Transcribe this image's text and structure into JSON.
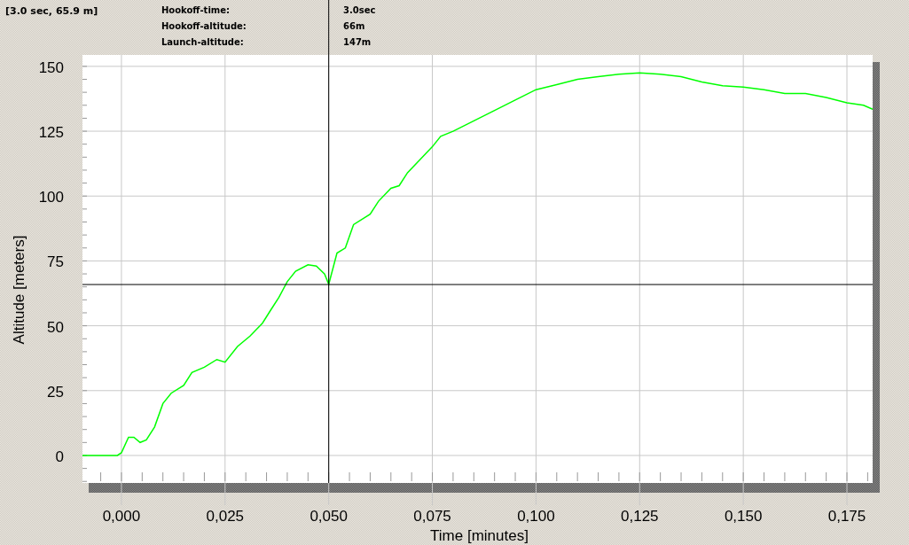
{
  "cursor_readout": "[3.0 sec, 65.9 m]",
  "stats": [
    {
      "label": "Hookoff-time:",
      "value": "3.0sec"
    },
    {
      "label": "Hookoff-altitude:",
      "value": "66m"
    },
    {
      "label": "Launch-altitude:",
      "value": "147m"
    }
  ],
  "chart": {
    "chart_data": {
      "type": "line",
      "xlabel": "Time [minutes]",
      "ylabel": "Altitude [meters]",
      "xlim": [
        -0.0094,
        0.1812
      ],
      "ylim": [
        -10.6,
        154.4
      ],
      "xticks": [
        {
          "value": 0,
          "label": "0,000"
        },
        {
          "value": 0.025,
          "label": "0,025"
        },
        {
          "value": 0.05,
          "label": "0,050"
        },
        {
          "value": 0.075,
          "label": "0,075"
        },
        {
          "value": 0.1,
          "label": "0,100"
        },
        {
          "value": 0.125,
          "label": "0,125"
        },
        {
          "value": 0.15,
          "label": "0,150"
        },
        {
          "value": 0.175,
          "label": "0,175"
        }
      ],
      "yticks": [
        0,
        25,
        50,
        75,
        100,
        125,
        150
      ],
      "x": [
        -0.0094,
        -0.001,
        0,
        0.0017,
        0.003,
        0.0045,
        0.006,
        0.008,
        0.01,
        0.012,
        0.015,
        0.017,
        0.02,
        0.023,
        0.025,
        0.028,
        0.031,
        0.034,
        0.036,
        0.038,
        0.04,
        0.042,
        0.045,
        0.047,
        0.049,
        0.05,
        0.052,
        0.054,
        0.056,
        0.06,
        0.062,
        0.065,
        0.067,
        0.069,
        0.072,
        0.075,
        0.077,
        0.08,
        0.085,
        0.09,
        0.095,
        0.1,
        0.105,
        0.11,
        0.115,
        0.12,
        0.125,
        0.13,
        0.135,
        0.14,
        0.145,
        0.15,
        0.155,
        0.16,
        0.165,
        0.17,
        0.175,
        0.179,
        0.1812
      ],
      "series": [
        {
          "color": "#00ff00",
          "values": [
            0,
            0,
            1,
            7,
            7,
            5,
            6,
            11,
            20,
            24,
            27,
            32,
            34,
            37,
            36,
            42,
            46,
            51,
            56,
            61,
            67,
            71,
            73.5,
            73,
            70,
            66,
            78,
            80,
            89,
            93,
            98,
            103,
            104,
            109,
            114,
            119,
            123,
            125,
            129,
            133,
            137,
            141,
            143,
            145,
            146,
            147,
            147.5,
            147,
            146,
            144,
            142.5,
            142,
            141,
            139.5,
            139.5,
            138,
            136,
            135,
            133.5
          ]
        }
      ],
      "grid": true,
      "ref_lines": [
        {
          "axis": "x",
          "value": 0.05
        },
        {
          "axis": "y",
          "value": 65.9
        }
      ]
    }
  }
}
